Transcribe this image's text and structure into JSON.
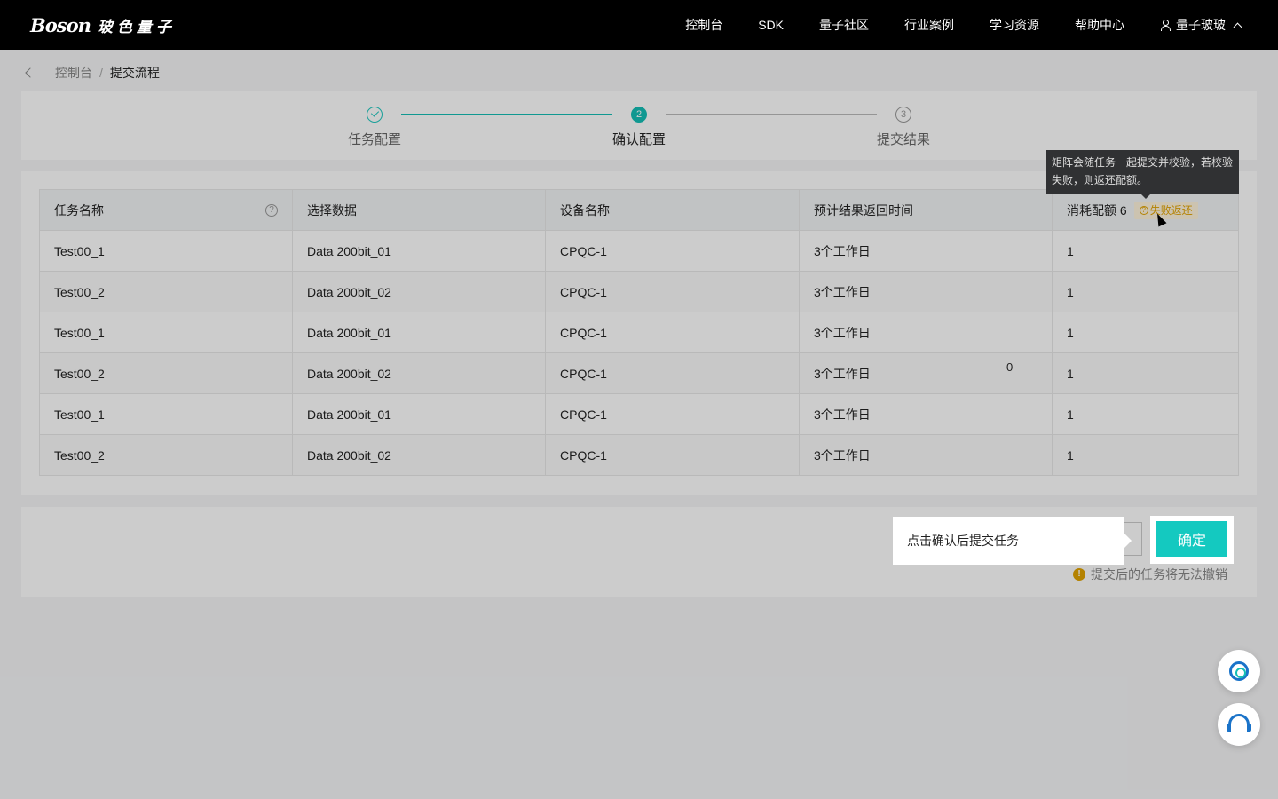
{
  "header": {
    "logo_text": "Boson",
    "logo_cn": "玻色量子",
    "nav": [
      "控制台",
      "SDK",
      "量子社区",
      "行业案例",
      "学习资源",
      "帮助中心"
    ],
    "user": "量子玻玻"
  },
  "breadcrumb": {
    "parent": "控制台",
    "separator": "/",
    "current": "提交流程"
  },
  "steps": [
    {
      "index": "",
      "label": "任务配置",
      "state": "done"
    },
    {
      "index": "2",
      "label": "确认配置",
      "state": "current"
    },
    {
      "index": "3",
      "label": "提交结果",
      "state": "waiting"
    }
  ],
  "table": {
    "headers": [
      "任务名称",
      "选择数据",
      "设备名称",
      "预计结果返回时间",
      "消耗配额 6"
    ],
    "help_icon_label": "?",
    "refund_tag": "失败返还",
    "rows": [
      [
        "Test00_1",
        "Data 200bit_01",
        "CPQC-1",
        "3个工作日",
        "1"
      ],
      [
        "Test00_2",
        "Data 200bit_02",
        "CPQC-1",
        "3个工作日",
        "1"
      ],
      [
        "Test00_1",
        "Data 200bit_01",
        "CPQC-1",
        "3个工作日",
        "1"
      ],
      [
        "Test00_2",
        "Data 200bit_02",
        "CPQC-1",
        "3个工作日",
        "1"
      ],
      [
        "Test00_1",
        "Data 200bit_01",
        "CPQC-1",
        "3个工作日",
        "1"
      ],
      [
        "Test00_2",
        "Data 200bit_02",
        "CPQC-1",
        "3个工作日",
        "1"
      ]
    ]
  },
  "tooltip": "矩阵会随任务一起提交并校验，若校验失败，则返还配额。",
  "stray_value": "0",
  "guide": {
    "text": "点击确认后提交任务"
  },
  "confirm_button": "确定",
  "hint": {
    "icon": "!",
    "text": "提交后的任务将无法撤销"
  },
  "colors": {
    "accent": "#14c9c0",
    "warning": "#e2a300",
    "header_bg": "#000000"
  }
}
